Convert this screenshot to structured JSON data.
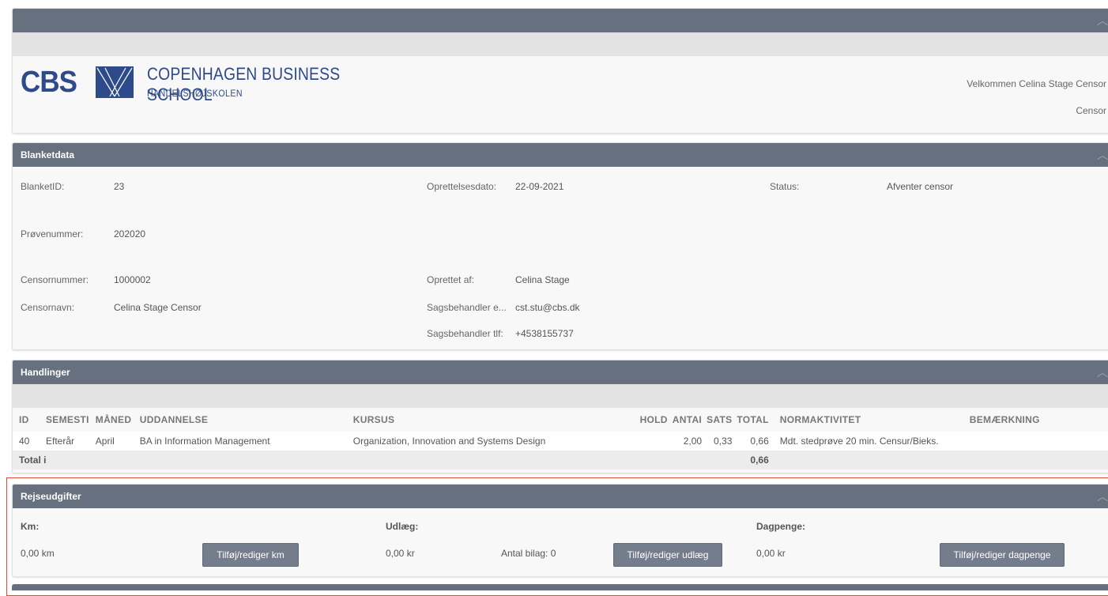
{
  "header": {
    "logo_letters": "CBS",
    "school_name": "COPENHAGEN BUSINESS SCHOOL",
    "school_sub": "HANDELSHØJSKOLEN",
    "welcome": "Velkommen Celina  Stage Censor",
    "role": "Censor"
  },
  "blanketdata": {
    "title": "Blanketdata",
    "blanket_id_label": "BlanketID:",
    "blanket_id": "23",
    "created_label": "Oprettelsesdato:",
    "created": "22-09-2021",
    "status_label": "Status:",
    "status": "Afventer censor",
    "exam_label": "Prøvenummer:",
    "exam": "202020",
    "censor_no_label": "Censornummer:",
    "censor_no": "1000002",
    "created_by_label": "Oprettet af:",
    "created_by": "Celina Stage",
    "censor_name_label": "Censornavn:",
    "censor_name": "Celina Stage Censor",
    "case_email_label": "Sagsbehandler e...",
    "case_email": "cst.stu@cbs.dk",
    "case_phone_label": "Sagsbehandler tlf:",
    "case_phone": "+4538155737"
  },
  "handlinger": {
    "title": "Handlinger",
    "columns": [
      "ID",
      "SEMESTI",
      "MÅNED",
      "UDDANNELSE",
      "KURSUS",
      "HOLD",
      "ANTAI",
      "SATS",
      "TOTAL",
      "NORMAKTIVITET",
      "BEMÆRKNING"
    ],
    "rows": [
      {
        "id": "40",
        "semester": "Efterår",
        "month": "April",
        "education": "BA in Information Management",
        "course": "Organization, Innovation and Systems Design",
        "hold": "",
        "count": "2,00",
        "rate": "0,33",
        "total": "0,66",
        "norm": "Mdt. stedprøve 20 min. Censur/Bieks.",
        "remark": ""
      }
    ],
    "total_label": "Total i",
    "total_value": "0,66"
  },
  "rejseudgifter": {
    "title": "Rejseudgifter",
    "km_label": "Km:",
    "km_value": "0,00 km",
    "km_button": "Tilføj/rediger km",
    "udlaeg_label": "Udlæg:",
    "udlaeg_value": "0,00 kr",
    "bilag": "Antal bilag: 0",
    "udlaeg_button": "Tilføj/rediger udlæg",
    "dagpenge_label": "Dagpenge:",
    "dagpenge_value": "0,00 kr",
    "dagpenge_button": "Tilføj/rediger dagpenge"
  },
  "colors": {
    "header_bar": "#66707f",
    "brand_blue": "#2d4a8a",
    "button": "#747d8b",
    "highlight": "#e04b3c"
  }
}
